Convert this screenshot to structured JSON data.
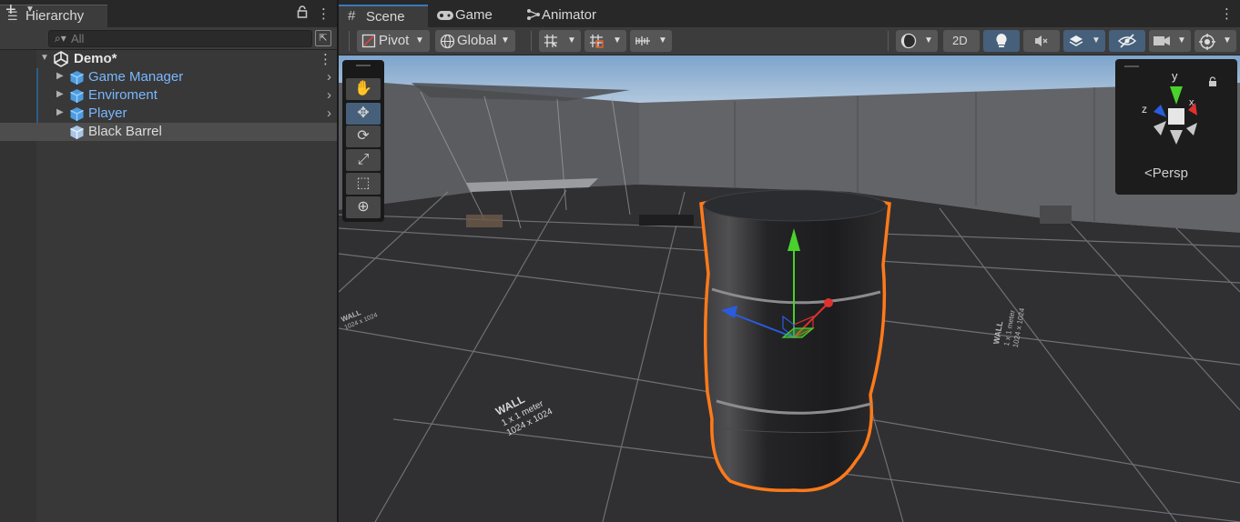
{
  "hierarchy": {
    "tab_label": "Hierarchy",
    "search_placeholder": "All",
    "root": "Demo*",
    "items": [
      {
        "label": "Game Manager"
      },
      {
        "label": "Enviroment"
      },
      {
        "label": "Player"
      },
      {
        "label": "Black Barrel"
      }
    ]
  },
  "scene_tabs": [
    {
      "label": "Scene"
    },
    {
      "label": "Game"
    },
    {
      "label": "Animator"
    }
  ],
  "toolbar": {
    "pivot": "Pivot",
    "global": "Global",
    "mode_2d": "2D"
  },
  "gizmo": {
    "projection": "Persp",
    "axis_x": "x",
    "axis_y": "y",
    "axis_z": "z"
  },
  "scene_labels": {
    "wall_title": "WALL",
    "wall_line1": "1 x 1 meter",
    "wall_line2": "1024 x 1024"
  },
  "colors": {
    "accent": "#3a79bb",
    "prefab_text": "#7bb7ff",
    "selection_outline": "#ff7a1a",
    "axis_x": "#e0312f",
    "axis_y": "#49d12c",
    "axis_z": "#2a5ce0"
  }
}
